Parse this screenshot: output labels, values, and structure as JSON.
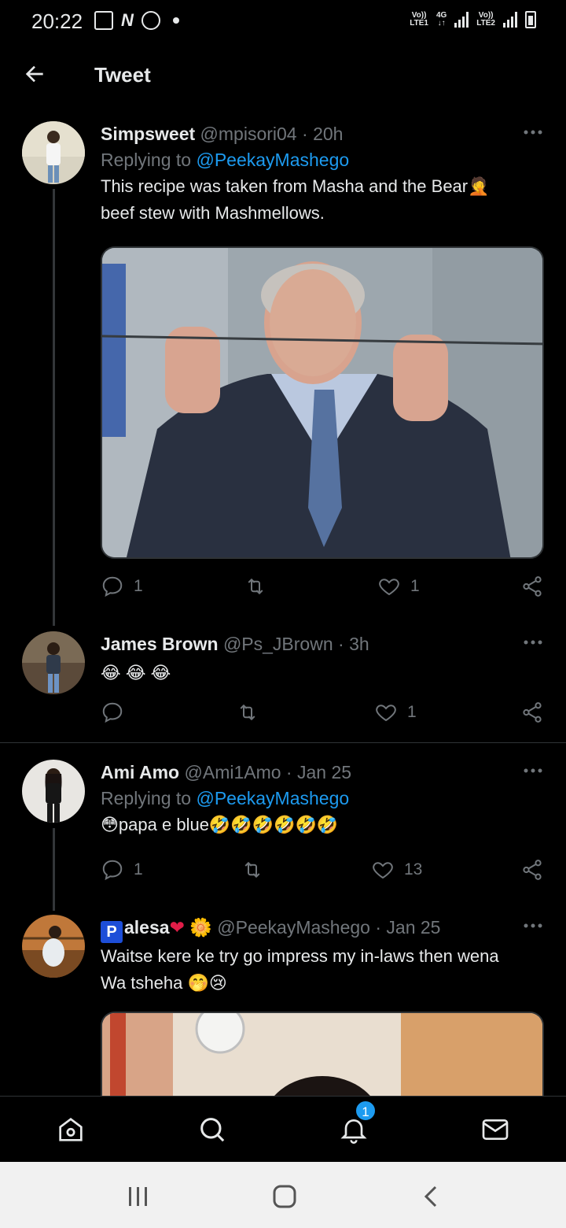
{
  "status_bar": {
    "time": "20:22",
    "net1_top": "Vo))",
    "net1_bottom": "LTE1",
    "net_4g": "4G",
    "net2_top": "Vo))",
    "net2_bottom": "LTE2"
  },
  "header": {
    "title": "Tweet",
    "back_icon": "arrow-left-icon"
  },
  "tweets": [
    {
      "name": "Simpsweet",
      "handle": "@mpisori04",
      "sep": " · ",
      "time": "20h",
      "replying_prefix": "Replying to ",
      "replying_to": "@PeekayMashego",
      "text_line1": "This recipe was taken from Masha and the Bear🤦",
      "text_line2": "beef stew with Mashmellows.",
      "reply_count": "1",
      "retweet_count": "",
      "like_count": "1"
    },
    {
      "name": "James Brown",
      "handle": "@Ps_JBrown",
      "sep": " · ",
      "time": "3h",
      "text": "😂 😂 😂",
      "reply_count": "",
      "retweet_count": "",
      "like_count": "1"
    },
    {
      "name": "Ami Amo",
      "handle": "@Ami1Amo",
      "sep": " · ",
      "time": "Jan 25",
      "replying_prefix": "Replying to ",
      "replying_to": "@PeekayMashego",
      "text": "😳papa e blue🤣🤣🤣🤣🤣🤣",
      "reply_count": "1",
      "retweet_count": "",
      "like_count": "13"
    },
    {
      "name_logo": "P",
      "name": "alesa",
      "name_heart": "❤",
      "name_flower": "🌼",
      "handle": "@PeekayMashego",
      "sep": " · ",
      "time": "Jan 25",
      "text_line1": "Waitse kere ke try go impress my in-laws then wena",
      "text_line2": "Wa tsheha 🤭😢"
    }
  ],
  "bottom_nav": {
    "notification_badge": "1"
  },
  "colors": {
    "background": "#000000",
    "accent": "#1d9bf0",
    "muted": "#71767b",
    "text": "#e7e9ea"
  }
}
